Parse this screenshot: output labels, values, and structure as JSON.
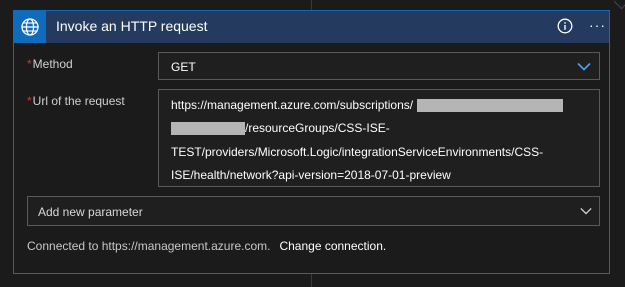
{
  "card": {
    "title": "Invoke an HTTP request",
    "icon": "globe-icon",
    "accent_color": "#0f6cbd",
    "header_color": "#243a5e"
  },
  "method": {
    "label": "Method",
    "required_marker": "*",
    "value": "GET"
  },
  "url": {
    "label": "Url of the request",
    "required_marker": "*",
    "lines": [
      "https://management.azure.com/subscriptions/",
      "/resourceGroups/CSS-ISE-",
      "TEST/providers/Microsoft.Logic/integrationServiceEnvironments/CSS-",
      "ISE/health/network?api-version=2018-07-01-preview"
    ]
  },
  "parameters": {
    "placeholder": "Add new parameter"
  },
  "connection": {
    "text": "Connected to https://management.azure.com.",
    "change_link": "Change connection."
  }
}
